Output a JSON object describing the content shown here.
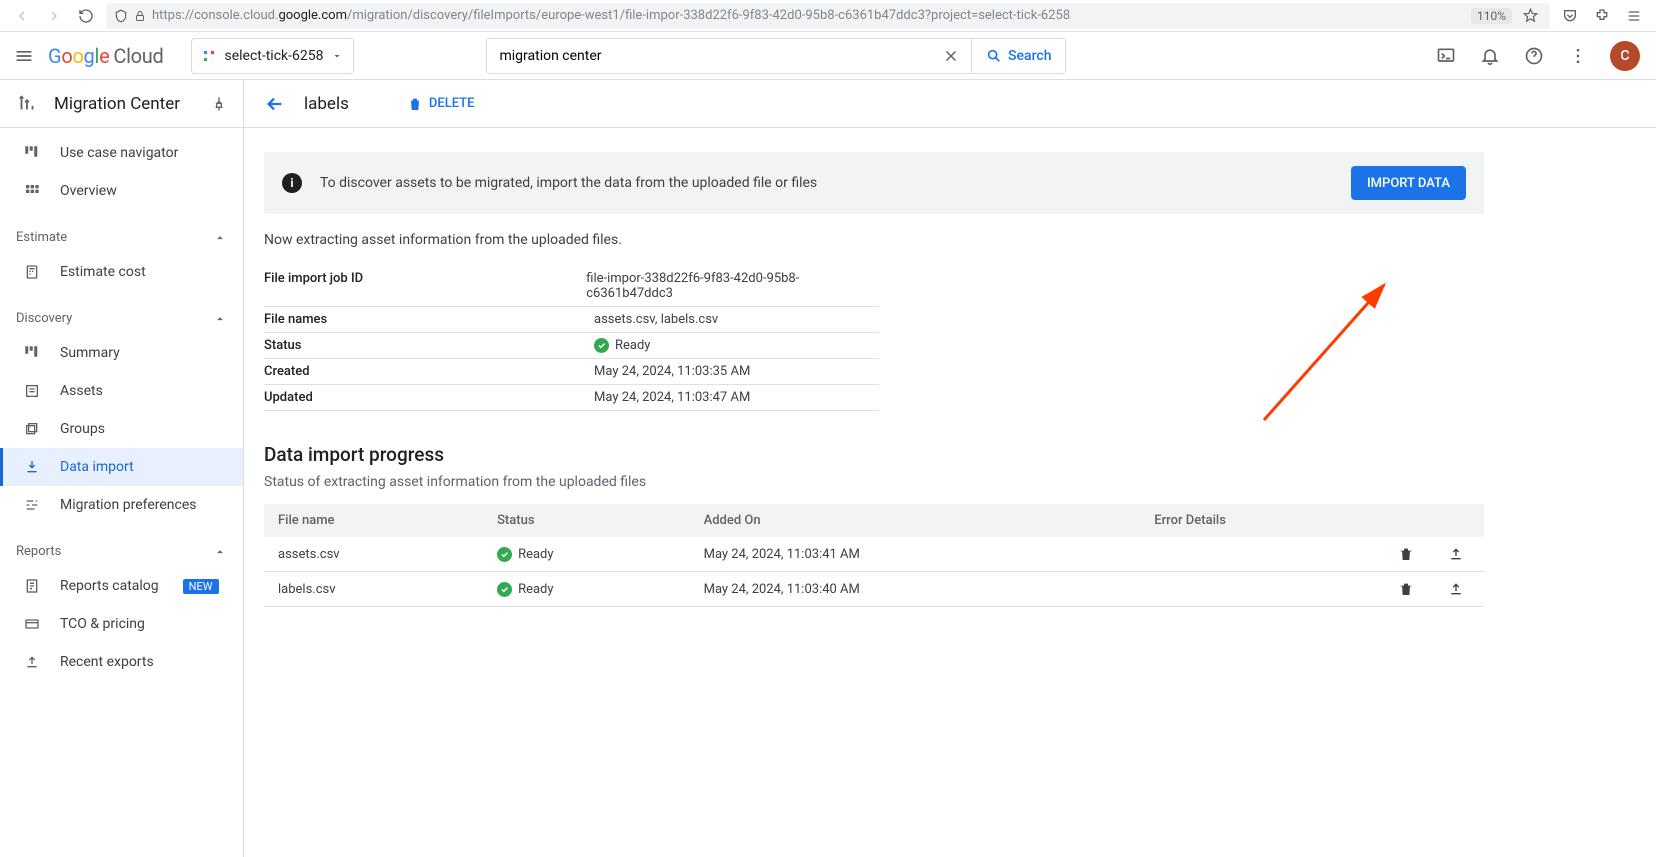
{
  "browser": {
    "url_prefix": "https://console.cloud.",
    "url_host": "google.com",
    "url_path": "/migration/discovery/fileImports/europe-west1/file-impor-338d22f6-9f83-42d0-95b8-c6361b47ddc3?project=select-tick-6258",
    "zoom": "110%"
  },
  "header": {
    "logo_cloud": "Cloud",
    "project": "select-tick-6258",
    "search_value": "migration center",
    "search_button": "Search",
    "avatar_letter": "C"
  },
  "sidebar": {
    "product_title": "Migration Center",
    "top_items": [
      {
        "label": "Use case navigator",
        "icon": "dashboard"
      },
      {
        "label": "Overview",
        "icon": "apps"
      }
    ],
    "sections": [
      {
        "heading": "Estimate",
        "items": [
          {
            "label": "Estimate cost",
            "icon": "calc"
          }
        ]
      },
      {
        "heading": "Discovery",
        "items": [
          {
            "label": "Summary",
            "icon": "dashboard"
          },
          {
            "label": "Assets",
            "icon": "listbox"
          },
          {
            "label": "Groups",
            "icon": "stack"
          },
          {
            "label": "Data import",
            "icon": "import",
            "active": true
          },
          {
            "label": "Migration preferences",
            "icon": "tune"
          }
        ]
      },
      {
        "heading": "Reports",
        "items": [
          {
            "label": "Reports catalog",
            "icon": "report",
            "badge": "NEW"
          },
          {
            "label": "TCO & pricing",
            "icon": "card"
          },
          {
            "label": "Recent exports",
            "icon": "upload"
          }
        ]
      }
    ]
  },
  "page": {
    "title": "labels",
    "delete_label": "DELETE",
    "banner_text": "To discover assets to be migrated, import the data from the uploaded file or files",
    "import_button": "IMPORT DATA",
    "extracting_text": "Now extracting asset information from the uploaded files.",
    "details": [
      {
        "label": "File import job ID",
        "value": "file-impor-338d22f6-9f83-42d0-95b8-c6361b47ddc3"
      },
      {
        "label": "File names",
        "value": "assets.csv, labels.csv"
      },
      {
        "label": "Status",
        "value": "Ready",
        "status": "ok"
      },
      {
        "label": "Created",
        "value": "May 24, 2024, 11:03:35 AM"
      },
      {
        "label": "Updated",
        "value": "May 24, 2024, 11:03:47 AM"
      }
    ],
    "progress_heading": "Data import progress",
    "progress_sub": "Status of extracting asset information from the uploaded files",
    "table": {
      "columns": [
        "File name",
        "Status",
        "Added On",
        "Error Details"
      ],
      "rows": [
        {
          "filename": "assets.csv",
          "status": "Ready",
          "added": "May 24, 2024, 11:03:41 AM",
          "errors": ""
        },
        {
          "filename": "labels.csv",
          "status": "Ready",
          "added": "May 24, 2024, 11:03:40 AM",
          "errors": ""
        }
      ]
    }
  }
}
